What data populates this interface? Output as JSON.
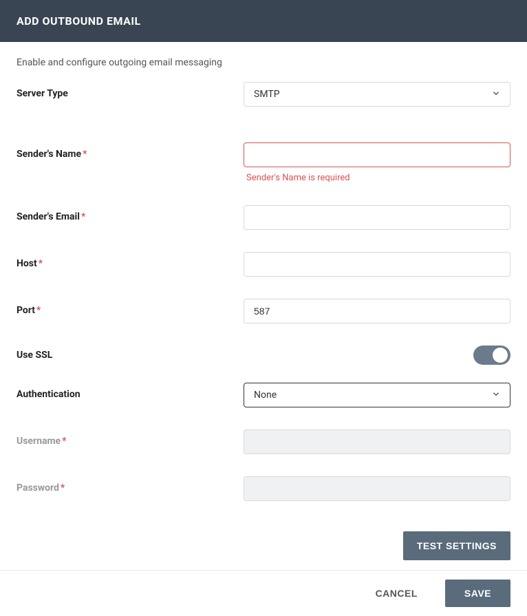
{
  "header": {
    "title": "ADD OUTBOUND EMAIL"
  },
  "description": "Enable and configure outgoing email messaging",
  "fields": {
    "server_type": {
      "label": "Server Type",
      "value": "SMTP"
    },
    "sender_name": {
      "label": "Sender's Name",
      "value": "",
      "error": "Sender's Name is required"
    },
    "sender_email": {
      "label": "Sender's Email",
      "value": ""
    },
    "host": {
      "label": "Host",
      "value": ""
    },
    "port": {
      "label": "Port",
      "value": "587"
    },
    "use_ssl": {
      "label": "Use SSL",
      "value": true
    },
    "authentication": {
      "label": "Authentication",
      "value": "None"
    },
    "username": {
      "label": "Username",
      "value": ""
    },
    "password": {
      "label": "Password",
      "value": ""
    }
  },
  "buttons": {
    "test": "TEST SETTINGS",
    "cancel": "CANCEL",
    "save": "SAVE"
  }
}
